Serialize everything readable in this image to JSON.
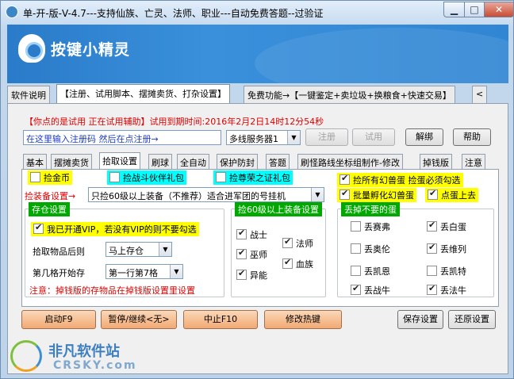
{
  "window": {
    "title": "单-开-版-V-4.7---支持仙族、亡灵、法师、职业---自动免费答题--过验证"
  },
  "banner": {
    "title": "按键小精灵"
  },
  "top_tabs": [
    "软件说明",
    "【注册、试用脚本、摆摊卖货、打杂设置】",
    "免费功能→【一键鉴定+卖垃圾+换粮食+快速交易】",
    "<"
  ],
  "status_text": "【你点的是试用 正在试用辅助】试用到期时间:2016年2月2日14时12分54秒",
  "register": {
    "input_value": "在这里输入注册码 然后在点注册→",
    "server_select": "多线服务器1",
    "btn_register": "注册",
    "btn_trial": "试用",
    "btn_unbind": "解绑",
    "btn_help": "帮助"
  },
  "inner_tabs": [
    "基本",
    "摆摊卖货",
    "拾取设置",
    "刷球",
    "全自动",
    "保护防封",
    "答题",
    "刷怪路线坐标组制作-修改",
    "掉钱版",
    "注意"
  ],
  "pickup": {
    "pick_gold": "捡金币",
    "pick_war_pet": "捡战斗伙伴礼包",
    "pick_honor": "捡尊荣之证礼包",
    "pick_all_eggs": "捡所有幻兽蛋 捡蛋必须勾选",
    "batch_hatch": "批量孵化幻兽蛋",
    "click_eggs": "点蛋上去",
    "equip_label": "捡装备设置→",
    "equip_select": "只捡60级以上装备（不推荐）适合进军团的号挂机"
  },
  "storage": {
    "title": "存仓设置",
    "vip_label": "我已开通VIP，若没有VIP的则不要勾选",
    "after_pick_label": "拾取物品后则",
    "after_pick_value": "马上存仓",
    "start_cell_label": "第几格开始存",
    "start_cell_value": "第一行第7格",
    "note": "注意：掉钱版的存物品在掉钱版设置里设置"
  },
  "lvl60": {
    "title": "捡60级以上装备设置",
    "warrior": "战士",
    "mage": "法师",
    "shaman": "巫师",
    "blood": "血族",
    "abnormal": "异能"
  },
  "discard_eggs": {
    "title": "丢掉不要的蛋",
    "items": [
      {
        "label": "丢赛弗",
        "checked": false
      },
      {
        "label": "丢白蛋",
        "checked": true
      },
      {
        "label": "丢奥伦",
        "checked": false
      },
      {
        "label": "丢维列",
        "checked": true
      },
      {
        "label": "丢凯恩",
        "checked": false
      },
      {
        "label": "丢凯特",
        "checked": false
      },
      {
        "label": "丢战牛",
        "checked": true
      },
      {
        "label": "丢法牛",
        "checked": true
      }
    ]
  },
  "bottom": {
    "start": "启动F9",
    "pause": "暂停/继续<无>",
    "stop": "中止F10",
    "hotkey": "修改热键",
    "save": "保存设置",
    "restore": "还原设置"
  },
  "watermark": {
    "title": "非凡软件站",
    "sub": "CRSKY.com"
  },
  "colors": {
    "accent": "#3186d3",
    "status_red": "#e00000",
    "highlight_yellow": "#ffff00",
    "highlight_cyan": "#00ffff",
    "group_green": "#00a800"
  }
}
